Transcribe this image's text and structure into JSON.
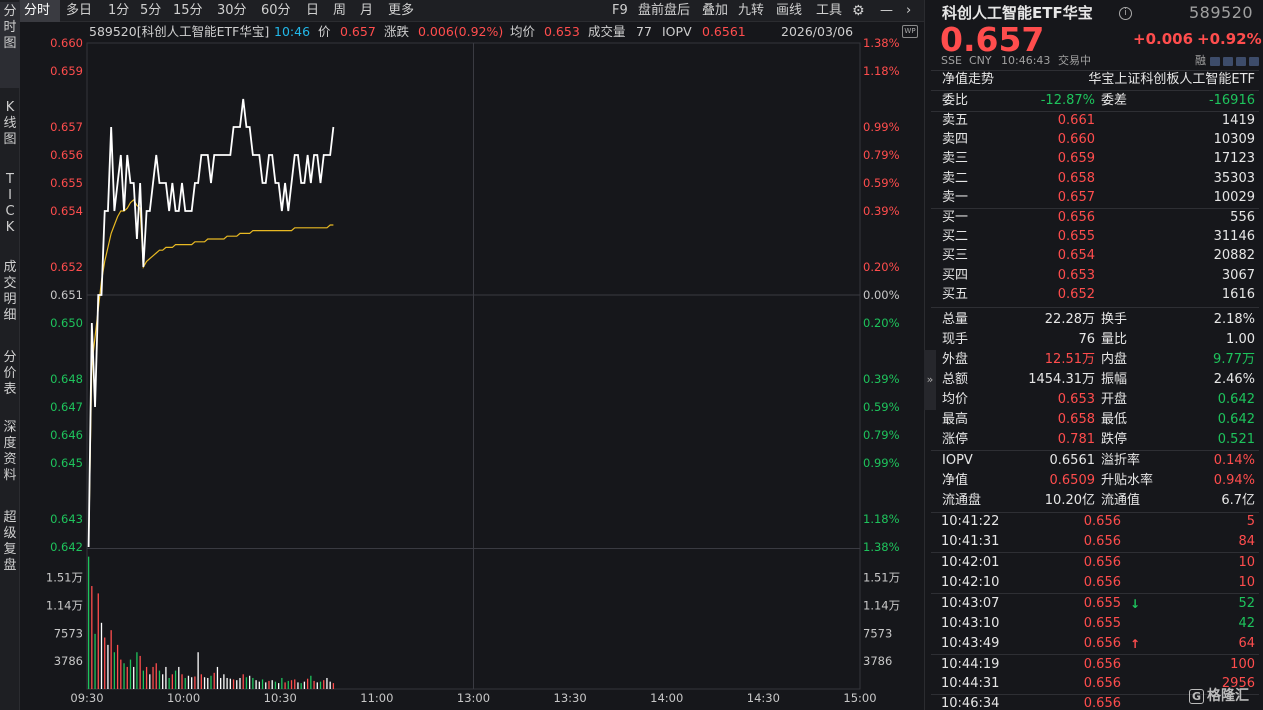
{
  "tabs_left": [
    {
      "label": "分\n时\n图",
      "active": true
    },
    {
      "label": "K\n线\n图",
      "active": false
    },
    {
      "label": "T\nI\nC\nK",
      "active": false
    },
    {
      "label": "成\n交\n明\n细",
      "active": false
    },
    {
      "label": "分\n价\n表",
      "active": false
    },
    {
      "label": "深\n度\n资\n料",
      "active": false
    },
    {
      "label": "超\n级\n复\n盘",
      "active": false
    }
  ],
  "toolbar": {
    "periods": [
      "分时",
      "多日",
      "1分",
      "5分",
      "15分",
      "30分",
      "60分",
      "日",
      "周",
      "月",
      "更多"
    ],
    "tools": [
      "F9",
      "盘前盘后",
      "叠加",
      "九转",
      "画线",
      "工具"
    ]
  },
  "header": {
    "name": "589520[科创人工智能ETF华宝]",
    "time": "10:46",
    "price_label": "价",
    "price": "0.657",
    "change_label": "涨跌",
    "change": "0.006(0.92%)",
    "avg_label": "均价",
    "avg": "0.653",
    "vol_label": "成交量",
    "vol": "77",
    "iopv_label": "IOPV",
    "iopv": "0.6561",
    "date": "2026/03/06"
  },
  "axis": {
    "price_ticks": [
      "0.660",
      "0.659",
      "0.657",
      "0.656",
      "0.655",
      "0.654",
      "0.652",
      "0.651",
      "0.650",
      "0.648",
      "0.647",
      "0.646",
      "0.645",
      "0.643",
      "0.642"
    ],
    "pct_ticks": [
      "1.38%",
      "1.18%",
      "0.99%",
      "0.79%",
      "0.59%",
      "0.39%",
      "0.20%",
      "0.00%",
      "0.20%",
      "0.39%",
      "0.59%",
      "0.79%",
      "0.99%",
      "1.18%",
      "1.38%"
    ],
    "vol_ticks": [
      "1.51万",
      "1.14万",
      "7573",
      "3786"
    ],
    "time_labels": [
      "09:30",
      "10:00",
      "10:30",
      "11:00",
      "13:00",
      "13:30",
      "14:00",
      "14:30",
      "15:00"
    ]
  },
  "chart_data": {
    "type": "line",
    "prev_close": 0.651,
    "ylim": [
      0.642,
      0.66
    ],
    "x": [
      "09:30",
      "09:31",
      "09:32",
      "09:33",
      "09:34",
      "09:35",
      "09:36",
      "09:37",
      "09:38",
      "09:39",
      "09:40",
      "09:41",
      "09:42",
      "09:43",
      "09:44",
      "09:45",
      "09:46",
      "09:47",
      "09:48",
      "09:49",
      "09:50",
      "09:51",
      "09:52",
      "09:53",
      "09:54",
      "09:55",
      "09:56",
      "09:57",
      "09:58",
      "09:59",
      "10:00",
      "10:01",
      "10:02",
      "10:03",
      "10:04",
      "10:05",
      "10:06",
      "10:07",
      "10:08",
      "10:09",
      "10:10",
      "10:11",
      "10:12",
      "10:13",
      "10:14",
      "10:15",
      "10:16",
      "10:17",
      "10:18",
      "10:19",
      "10:20",
      "10:21",
      "10:22",
      "10:23",
      "10:24",
      "10:25",
      "10:26",
      "10:27",
      "10:28",
      "10:29",
      "10:30",
      "10:31",
      "10:32",
      "10:33",
      "10:34",
      "10:35",
      "10:36",
      "10:37",
      "10:38",
      "10:39",
      "10:40",
      "10:41",
      "10:42",
      "10:43",
      "10:44",
      "10:45",
      "10:46"
    ],
    "series": [
      {
        "values": [
          0.642,
          0.65,
          0.647,
          0.651,
          0.651,
          0.654,
          0.654,
          0.657,
          0.654,
          0.655,
          0.656,
          0.654,
          0.656,
          0.655,
          0.655,
          0.653,
          0.655,
          0.652,
          0.654,
          0.654,
          0.655,
          0.656,
          0.655,
          0.655,
          0.655,
          0.654,
          0.655,
          0.654,
          0.654,
          0.655,
          0.654,
          0.654,
          0.654,
          0.655,
          0.655,
          0.656,
          0.656,
          0.656,
          0.655,
          0.656,
          0.656,
          0.656,
          0.656,
          0.656,
          0.656,
          0.657,
          0.657,
          0.657,
          0.658,
          0.657,
          0.657,
          0.656,
          0.656,
          0.656,
          0.655,
          0.655,
          0.656,
          0.656,
          0.655,
          0.655,
          0.654,
          0.655,
          0.654,
          0.655,
          0.656,
          0.656,
          0.655,
          0.655,
          0.656,
          0.655,
          0.656,
          0.656,
          0.655,
          0.656,
          0.656,
          0.656,
          0.657
        ]
      },
      {
        "values": [
          0.642,
          0.6485,
          0.6495,
          0.6505,
          0.6515,
          0.6522,
          0.6527,
          0.6532,
          0.6535,
          0.6538,
          0.654,
          0.654,
          0.6541,
          0.6543,
          0.6544,
          0.6542,
          0.6541,
          0.652,
          0.6522,
          0.6523,
          0.6524,
          0.6525,
          0.6526,
          0.6526,
          0.6527,
          0.6527,
          0.6527,
          0.6528,
          0.6528,
          0.6528,
          0.6528,
          0.6528,
          0.6528,
          0.6529,
          0.6529,
          0.6529,
          0.6529,
          0.653,
          0.653,
          0.653,
          0.653,
          0.653,
          0.653,
          0.6531,
          0.6531,
          0.6531,
          0.6531,
          0.6532,
          0.6532,
          0.6532,
          0.6532,
          0.6533,
          0.6533,
          0.6533,
          0.6533,
          0.6533,
          0.6533,
          0.6533,
          0.6533,
          0.6533,
          0.6533,
          0.6533,
          0.6533,
          0.6533,
          0.6534,
          0.6534,
          0.6534,
          0.6534,
          0.6534,
          0.6534,
          0.6534,
          0.6534,
          0.6534,
          0.6534,
          0.6534,
          0.6535,
          0.6535
        ]
      }
    ],
    "volume": [
      18000,
      14000,
      7500,
      13000,
      9000,
      7000,
      6000,
      8000,
      5000,
      6000,
      4000,
      3500,
      3000,
      4000,
      3000,
      5000,
      4500,
      2500,
      3000,
      2000,
      3000,
      3500,
      2500,
      2000,
      3000,
      1500,
      2000,
      2500,
      3000,
      2000,
      1500,
      1800,
      1600,
      1700,
      5000,
      2000,
      1600,
      1500,
      1800,
      2200,
      3000,
      1500,
      2000,
      1500,
      1400,
      1300,
      1200,
      1500,
      2000,
      1600,
      1800,
      1500,
      1200,
      1000,
      1300,
      900,
      1100,
      1200,
      1000,
      800,
      1500,
      900,
      1100,
      1200,
      1300,
      900,
      800,
      1000,
      1400,
      1800,
      1100,
      900,
      1000,
      1200,
      1500,
      1000,
      800
    ],
    "volume_ylim": [
      0,
      18900
    ]
  },
  "quote": {
    "name": "科创人工智能ETF华宝",
    "code": "589520",
    "price": "0.657",
    "change": "+0.006",
    "change_pct": "+0.92%",
    "exchange": "SSE",
    "currency": "CNY",
    "time": "10:46:43",
    "status": "交易中",
    "nav_trend": "净值走势",
    "fund_name": "华宝上证科创板人工智能ETF",
    "weibi_label": "委比",
    "weibi": "-12.87%",
    "weicha_label": "委差",
    "weicha": "-16916",
    "asks": [
      {
        "label": "卖五",
        "price": "0.661",
        "vol": "1419"
      },
      {
        "label": "卖四",
        "price": "0.660",
        "vol": "10309"
      },
      {
        "label": "卖三",
        "price": "0.659",
        "vol": "17123"
      },
      {
        "label": "卖二",
        "price": "0.658",
        "vol": "35303"
      },
      {
        "label": "卖一",
        "price": "0.657",
        "vol": "10029"
      }
    ],
    "bids": [
      {
        "label": "买一",
        "price": "0.656",
        "vol": "556"
      },
      {
        "label": "买二",
        "price": "0.655",
        "vol": "31146"
      },
      {
        "label": "买三",
        "price": "0.654",
        "vol": "20882"
      },
      {
        "label": "买四",
        "price": "0.653",
        "vol": "3067"
      },
      {
        "label": "买五",
        "price": "0.652",
        "vol": "1616"
      }
    ],
    "stats": [
      {
        "l1": "总量",
        "v1": "22.28万",
        "c1": "white",
        "l2": "换手",
        "v2": "2.18%",
        "c2": "white"
      },
      {
        "l1": "现手",
        "v1": "76",
        "c1": "white",
        "l2": "量比",
        "v2": "1.00",
        "c2": "white"
      },
      {
        "l1": "外盘",
        "v1": "12.51万",
        "c1": "red",
        "l2": "内盘",
        "v2": "9.77万",
        "c2": "green"
      },
      {
        "l1": "总额",
        "v1": "1454.31万",
        "c1": "white",
        "l2": "振幅",
        "v2": "2.46%",
        "c2": "white"
      },
      {
        "l1": "均价",
        "v1": "0.653",
        "c1": "red",
        "l2": "开盘",
        "v2": "0.642",
        "c2": "green"
      },
      {
        "l1": "最高",
        "v1": "0.658",
        "c1": "red",
        "l2": "最低",
        "v2": "0.642",
        "c2": "green"
      },
      {
        "l1": "涨停",
        "v1": "0.781",
        "c1": "red",
        "l2": "跌停",
        "v2": "0.521",
        "c2": "green"
      }
    ],
    "fund": [
      {
        "l1": "IOPV",
        "v1": "0.6561",
        "c1": "white",
        "l2": "溢折率",
        "v2": "0.14%",
        "c2": "red"
      },
      {
        "l1": "净值",
        "v1": "0.6509",
        "c1": "red",
        "l2": "升贴水率",
        "v2": "0.94%",
        "c2": "red"
      },
      {
        "l1": "流通盘",
        "v1": "10.20亿",
        "c1": "white",
        "l2": "流通值",
        "v2": "6.7亿",
        "c2": "white"
      }
    ],
    "ticks": [
      {
        "t": "10:41:22",
        "p": "0.656",
        "v": "5",
        "vc": "red",
        "arrow": ""
      },
      {
        "t": "10:41:31",
        "p": "0.656",
        "v": "84",
        "vc": "red",
        "arrow": ""
      },
      {
        "t": "10:42:01",
        "p": "0.656",
        "v": "10",
        "vc": "red",
        "arrow": ""
      },
      {
        "t": "10:42:10",
        "p": "0.656",
        "v": "10",
        "vc": "red",
        "arrow": ""
      },
      {
        "t": "10:43:07",
        "p": "0.655",
        "v": "52",
        "vc": "green",
        "arrow": "↓"
      },
      {
        "t": "10:43:10",
        "p": "0.655",
        "v": "42",
        "vc": "green",
        "arrow": ""
      },
      {
        "t": "10:43:49",
        "p": "0.656",
        "v": "64",
        "vc": "red",
        "arrow": "↑"
      },
      {
        "t": "10:44:19",
        "p": "0.656",
        "v": "100",
        "vc": "red",
        "arrow": ""
      },
      {
        "t": "10:44:31",
        "p": "0.656",
        "v": "2956",
        "vc": "red",
        "arrow": ""
      },
      {
        "t": "10:46:34",
        "p": "0.656",
        "v": "",
        "vc": "red",
        "arrow": ""
      }
    ],
    "rong": "融"
  },
  "watermark": "格隆汇",
  "colors": {
    "up": "#ff4d4d",
    "down": "#1ec35c",
    "avg": "#e8b923",
    "price_line": "#ffffff"
  }
}
